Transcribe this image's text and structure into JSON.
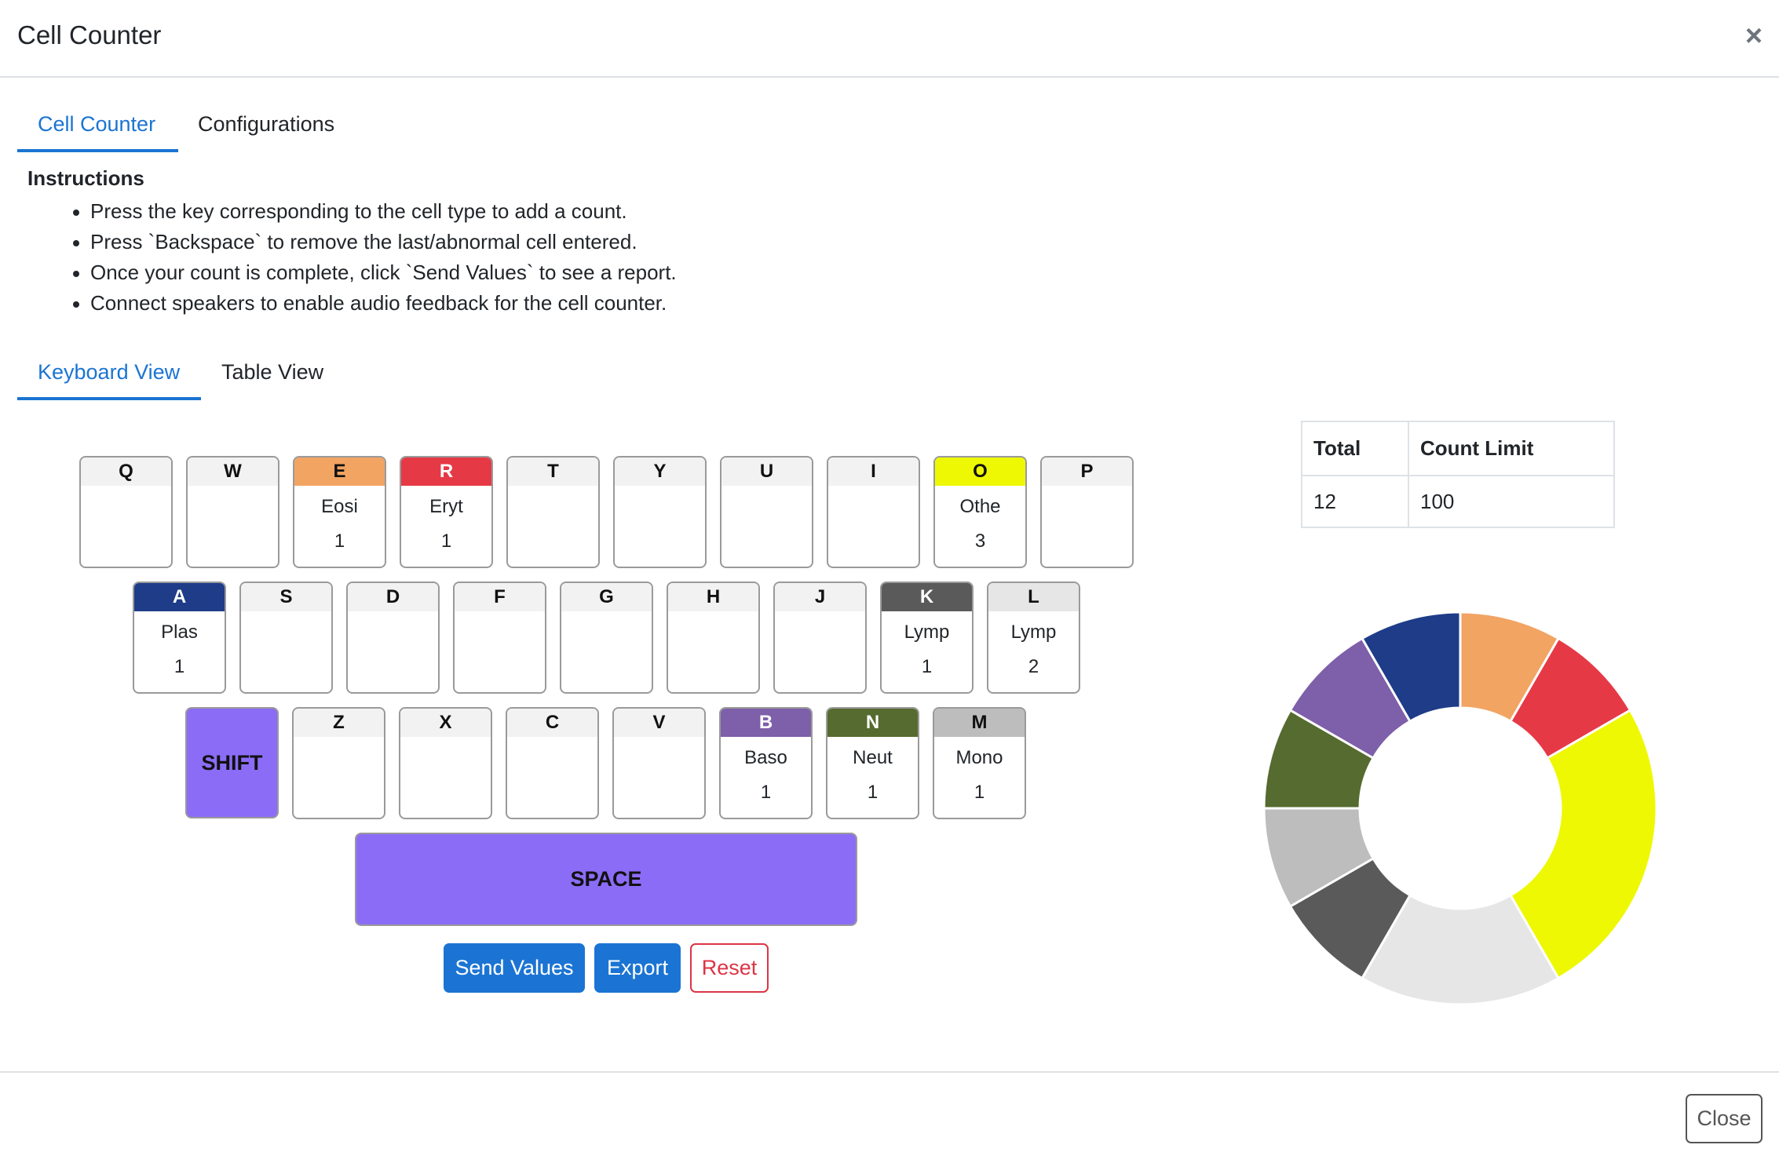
{
  "modal": {
    "title": "Cell Counter",
    "close_label": "Close"
  },
  "tabs": [
    {
      "label": "Cell Counter",
      "active": true
    },
    {
      "label": "Configurations",
      "active": false
    }
  ],
  "instructions": {
    "title": "Instructions",
    "items": [
      "Press the key corresponding to the cell type to add a count.",
      "Press `Backspace` to remove the last/abnormal cell entered.",
      "Once your count is complete, click `Send Values` to see a report.",
      "Connect speakers to enable audio feedback for the cell counter."
    ]
  },
  "view_tabs": [
    {
      "label": "Keyboard View",
      "active": true
    },
    {
      "label": "Table View",
      "active": false
    }
  ],
  "keyboard": {
    "rows": [
      [
        {
          "key": "Q",
          "name": "",
          "count": "",
          "color": ""
        },
        {
          "key": "W",
          "name": "",
          "count": "",
          "color": ""
        },
        {
          "key": "E",
          "name": "Eosi",
          "count": "1",
          "color": "#f2a463"
        },
        {
          "key": "R",
          "name": "Eryt",
          "count": "1",
          "color": "#e63946"
        },
        {
          "key": "T",
          "name": "",
          "count": "",
          "color": ""
        },
        {
          "key": "Y",
          "name": "",
          "count": "",
          "color": ""
        },
        {
          "key": "U",
          "name": "",
          "count": "",
          "color": ""
        },
        {
          "key": "I",
          "name": "",
          "count": "",
          "color": ""
        },
        {
          "key": "O",
          "name": "Othe",
          "count": "3",
          "color": "#eef802"
        },
        {
          "key": "P",
          "name": "",
          "count": "",
          "color": ""
        }
      ],
      [
        {
          "key": "A",
          "name": "Plas",
          "count": "1",
          "color": "#1e3c88"
        },
        {
          "key": "S",
          "name": "",
          "count": "",
          "color": ""
        },
        {
          "key": "D",
          "name": "",
          "count": "",
          "color": ""
        },
        {
          "key": "F",
          "name": "",
          "count": "",
          "color": ""
        },
        {
          "key": "G",
          "name": "",
          "count": "",
          "color": ""
        },
        {
          "key": "H",
          "name": "",
          "count": "",
          "color": ""
        },
        {
          "key": "J",
          "name": "",
          "count": "",
          "color": ""
        },
        {
          "key": "K",
          "name": "Lymp",
          "count": "1",
          "color": "#5a5a5a"
        },
        {
          "key": "L",
          "name": "Lymp",
          "count": "2",
          "color": "#e6e6e6"
        }
      ],
      [
        {
          "key": "Z",
          "name": "",
          "count": "",
          "color": ""
        },
        {
          "key": "X",
          "name": "",
          "count": "",
          "color": ""
        },
        {
          "key": "C",
          "name": "",
          "count": "",
          "color": ""
        },
        {
          "key": "V",
          "name": "",
          "count": "",
          "color": ""
        },
        {
          "key": "B",
          "name": "Baso",
          "count": "1",
          "color": "#7e5fa9"
        },
        {
          "key": "N",
          "name": "Neut",
          "count": "1",
          "color": "#556b2f"
        },
        {
          "key": "M",
          "name": "Mono",
          "count": "1",
          "color": "#bdbdbd"
        }
      ]
    ],
    "shift_label": "SHIFT",
    "space_label": "SPACE",
    "modifier_color": "#8b6cf7"
  },
  "actions": {
    "send_label": "Send Values",
    "export_label": "Export",
    "reset_label": "Reset"
  },
  "summary": {
    "headers": [
      "Total",
      "Count Limit"
    ],
    "values": [
      "12",
      "100"
    ]
  },
  "chart_data": {
    "type": "pie",
    "variant": "donut",
    "slices": [
      {
        "label": "Eosi",
        "value": 1,
        "color": "#f2a463"
      },
      {
        "label": "Eryt",
        "value": 1,
        "color": "#e63946"
      },
      {
        "label": "Othe",
        "value": 3,
        "color": "#eef802"
      },
      {
        "label": "Lymp",
        "value": 2,
        "color": "#e6e6e6"
      },
      {
        "label": "Lymp",
        "value": 1,
        "color": "#5a5a5a"
      },
      {
        "label": "Mono",
        "value": 1,
        "color": "#bdbdbd"
      },
      {
        "label": "Neut",
        "value": 1,
        "color": "#556b2f"
      },
      {
        "label": "Baso",
        "value": 1,
        "color": "#7e5fa9"
      },
      {
        "label": "Plas",
        "value": 1,
        "color": "#1e3c88"
      }
    ],
    "legend": "none"
  }
}
